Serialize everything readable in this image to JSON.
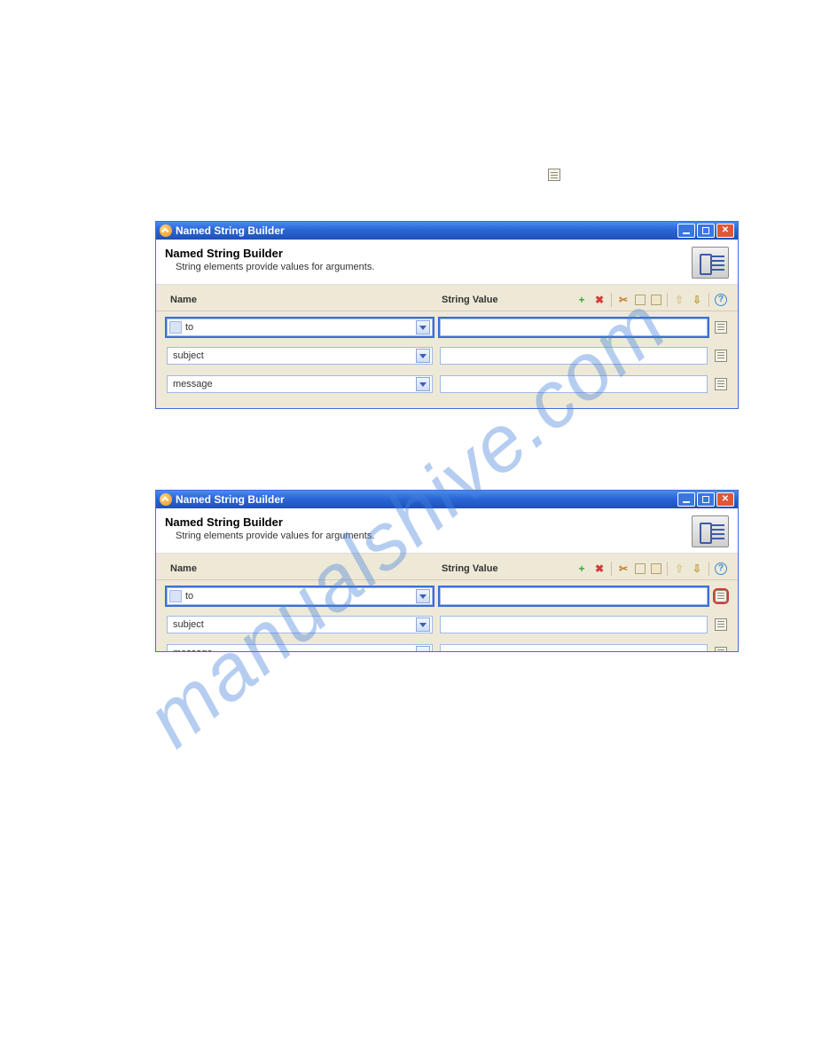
{
  "watermark": "manualshive.com",
  "windowTitle": "Named String Builder",
  "panelHeading": "Named String Builder",
  "panelSubheading": "String elements provide values for arguments.",
  "columns": {
    "name": "Name",
    "value": "String Value"
  },
  "dialog1": {
    "rows": [
      {
        "name": "to",
        "value": ""
      },
      {
        "name": "subject",
        "value": ""
      },
      {
        "name": "message",
        "value": ""
      }
    ]
  },
  "dialog2": {
    "rows": [
      {
        "name": "to",
        "value": ""
      },
      {
        "name": "subject",
        "value": ""
      },
      {
        "name": "message",
        "value": ""
      }
    ]
  }
}
